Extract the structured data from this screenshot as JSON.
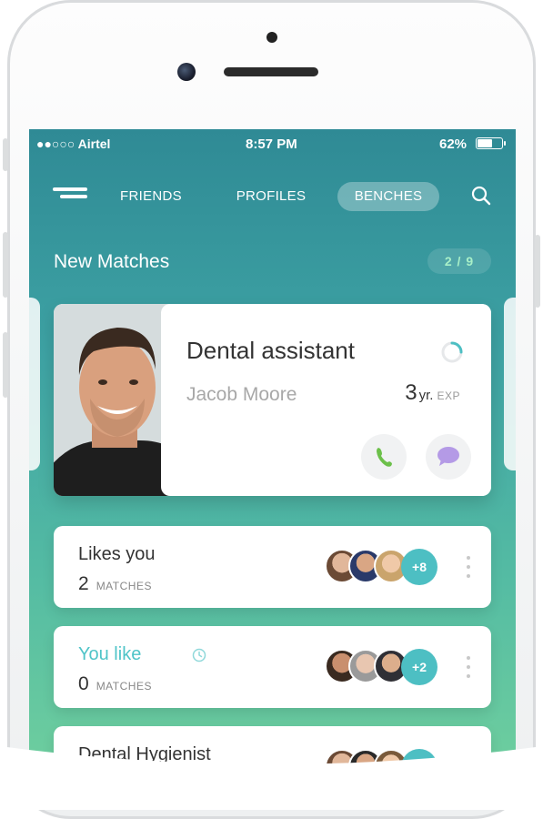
{
  "status_bar": {
    "carrier": "●●○○○ Airtel",
    "time": "8:57 PM",
    "battery_percent": "62%",
    "battery_level": 0.62
  },
  "nav": {
    "tabs": [
      {
        "label": "FRIENDS",
        "active": false
      },
      {
        "label": "PROFILES",
        "active": false
      },
      {
        "label": "BENCHES",
        "active": true
      }
    ]
  },
  "new_matches": {
    "title": "New Matches",
    "counter": "2 / 9"
  },
  "match_card": {
    "job_title": "Dental assistant",
    "name": "Jacob Moore",
    "exp_value": "3",
    "exp_yr": "yr.",
    "exp_unit": "EXP"
  },
  "lists": [
    {
      "title": "Likes you",
      "count": "2",
      "unit": "MATCHES",
      "more": "+8"
    },
    {
      "title": "You like",
      "count": "0",
      "unit": "MATCHES",
      "more": "+2"
    },
    {
      "title": "Dental Hygienist",
      "count": "",
      "unit": "",
      "more": ""
    }
  ],
  "colors": {
    "accent": "#4dbfc3",
    "gradient_top": "#2f8a95",
    "gradient_bottom": "#6fcf9e",
    "phone_icon": "#6cc04a",
    "chat_icon": "#b49ae6"
  },
  "icons": [
    "menu-icon",
    "search-icon",
    "progress-ring-icon",
    "phone-icon",
    "chat-bubble-icon",
    "clock-icon",
    "kebab-menu-icon"
  ]
}
